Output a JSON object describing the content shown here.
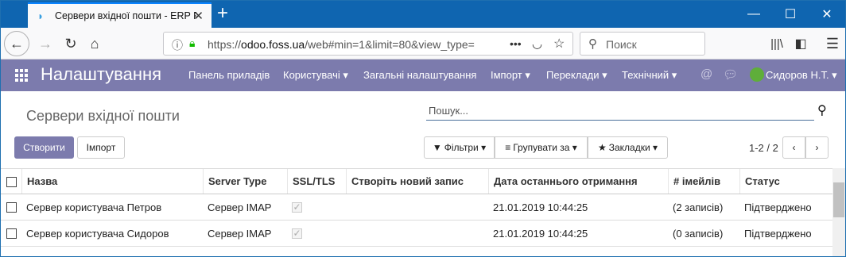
{
  "browser": {
    "tab_title": "Сервери вхідної пошти - ERP F",
    "url_prefix": "https://",
    "url_domain": "odoo.foss.ua",
    "url_path": "/web#min=1&limit=80&view_type=",
    "url_more": "•••",
    "search_placeholder": "Поиск",
    "new_tab": "+",
    "minimize": "—",
    "maximize": "☐",
    "close": "✕"
  },
  "header": {
    "app_title": "Налаштування",
    "menus": [
      "Панель приладів",
      "Користувачі ▾",
      "Загальні налаштування",
      "Імпорт ▾",
      "Переклади ▾",
      "Технічний ▾"
    ],
    "user": "Сидоров Н.Т. ▾"
  },
  "control": {
    "page_title": "Сервери вхідної пошти",
    "search_placeholder": "Пошук...",
    "create_label": "Створити",
    "import_label": "Імпорт",
    "filters_label": "Фільтри ▾",
    "group_label": "Групувати за ▾",
    "favorites_label": "Закладки ▾",
    "pager": "1-2 / 2"
  },
  "table": {
    "columns": [
      "Назва",
      "Server Type",
      "SSL/TLS",
      "Створіть новий запис",
      "Дата останнього отримання",
      "# імейлів",
      "Статус"
    ],
    "rows": [
      {
        "name": "Сервер користувача Петров",
        "type": "Сервер IMAP",
        "ssl": true,
        "date": "21.01.2019 10:44:25",
        "emails": "(2 записів)",
        "status": "Підтверджено"
      },
      {
        "name": "Сервер користувача Сидоров",
        "type": "Сервер IMAP",
        "ssl": true,
        "date": "21.01.2019 10:44:25",
        "emails": "(0 записів)",
        "status": "Підтверджено"
      }
    ]
  },
  "colors": {
    "brand": "#7c7bad",
    "titlebar": "#0f65b0"
  }
}
